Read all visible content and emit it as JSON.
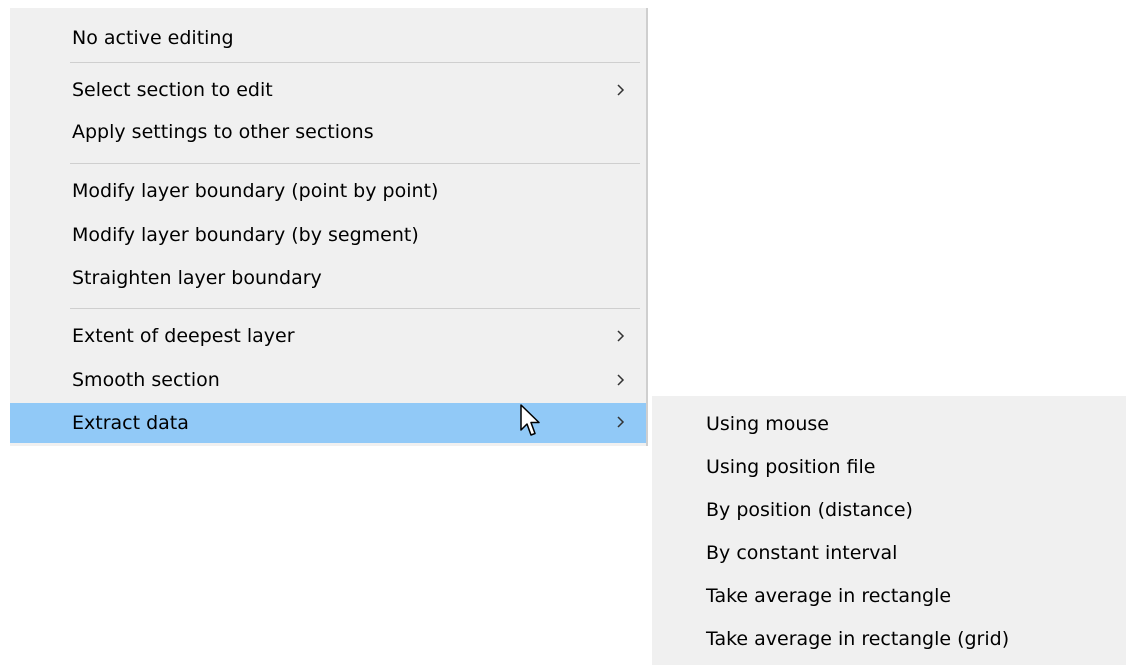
{
  "context_menu": {
    "items": [
      {
        "label": "No active editing"
      },
      {
        "label": "Select section to edit",
        "submenu": true
      },
      {
        "label": "Apply settings to other sections"
      },
      {
        "label": "Modify layer boundary (point by point)"
      },
      {
        "label": "Modify layer boundary (by segment)"
      },
      {
        "label": "Straighten layer boundary"
      },
      {
        "label": "Extent of deepest layer",
        "submenu": true
      },
      {
        "label": "Smooth section",
        "submenu": true
      },
      {
        "label": "Extract data",
        "submenu": true,
        "highlighted": true
      }
    ],
    "submenu_icon": "chevron-right-icon"
  },
  "extract_data_submenu": {
    "items": [
      {
        "label": "Using mouse"
      },
      {
        "label": "Using position file"
      },
      {
        "label": "By position (distance)"
      },
      {
        "label": "By constant interval"
      },
      {
        "label": "Take average in rectangle"
      },
      {
        "label": "Take average in rectangle (grid)"
      }
    ]
  },
  "colors": {
    "menu_background": "#f0f0f0",
    "highlight": "#91c9f7",
    "separator": "#cfcfcf"
  },
  "cursor": "arrow-cursor-icon"
}
